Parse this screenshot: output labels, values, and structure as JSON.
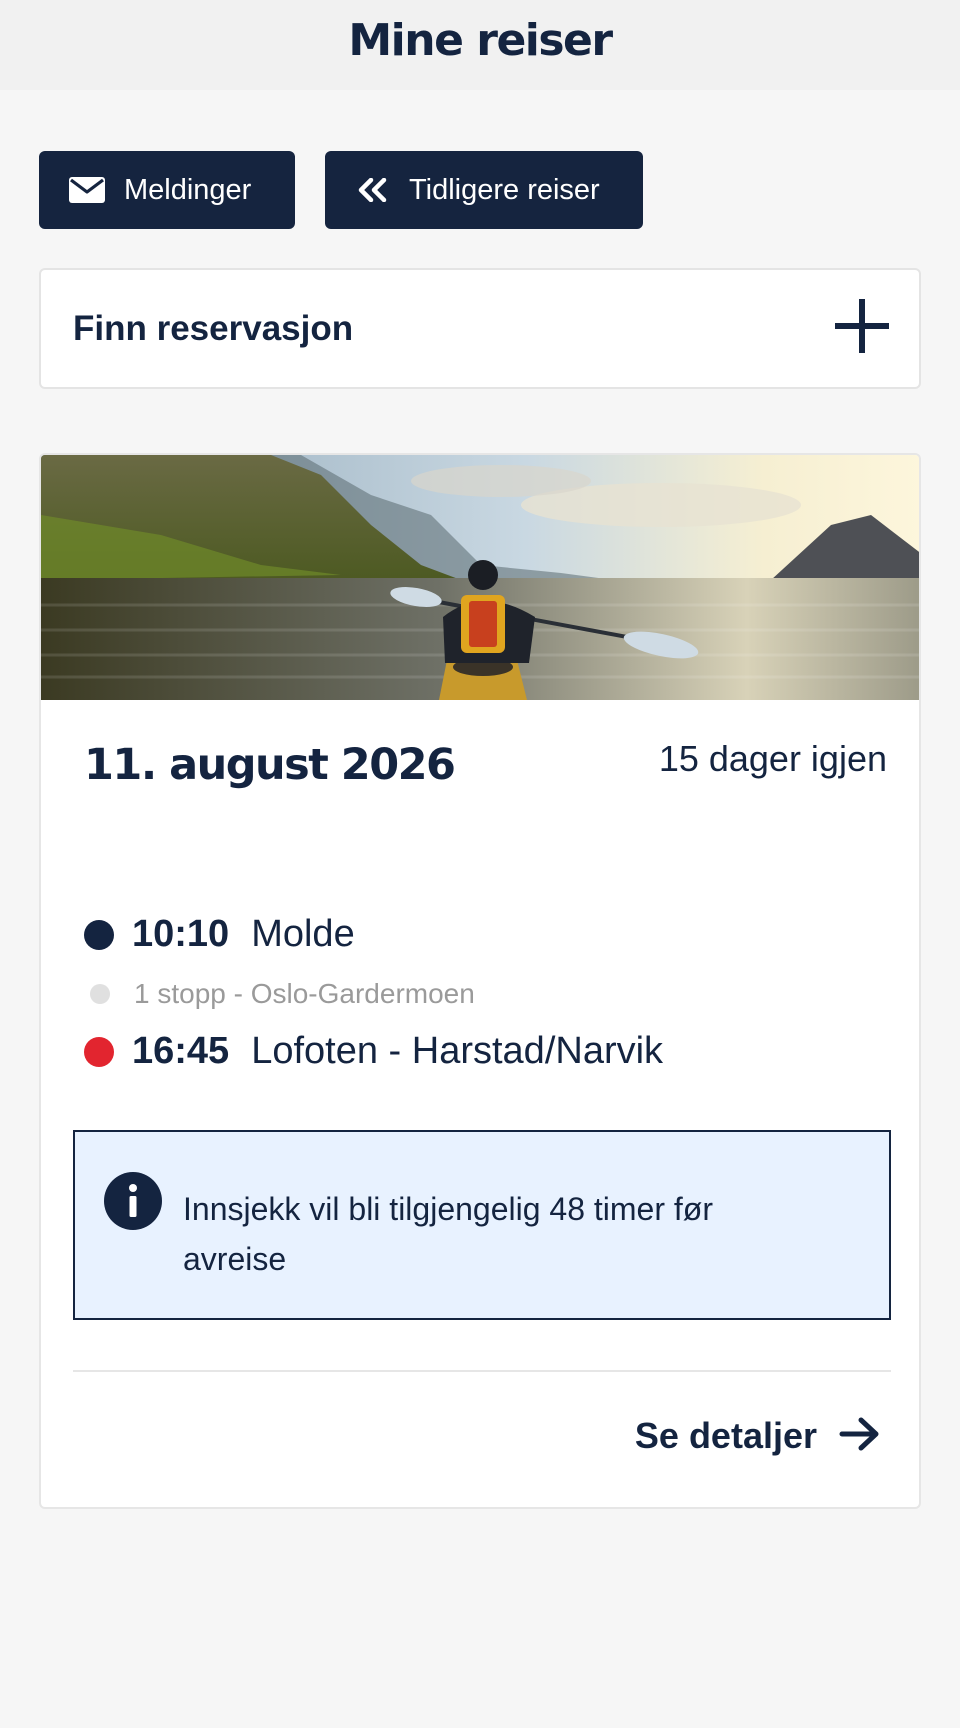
{
  "header": {
    "title": "Mine reiser"
  },
  "actions": {
    "messages": {
      "label": "Meldinger",
      "icon": "envelope-icon"
    },
    "previous_trips": {
      "label": "Tidligere reiser",
      "icon": "double-chevron-left-icon"
    }
  },
  "find_reservation": {
    "label": "Finn reservasjon",
    "icon": "plus-icon"
  },
  "trip": {
    "image": "kayak-fjord-photo",
    "date": "11. august 2026",
    "countdown": "15 dager igjen",
    "departure": {
      "time": "10:10",
      "place": "Molde",
      "dot_color": "#142440"
    },
    "stopover": {
      "text": "1 stopp - Oslo-Gardermoen",
      "dot_color": "#e0e0e0"
    },
    "arrival": {
      "time": "16:45",
      "place": "Lofoten - Harstad/Narvik",
      "dot_color": "#e2252f"
    },
    "info": {
      "icon": "info-icon",
      "text": "Innsjekk vil bli tilgjengelig 48 timer før avreise"
    },
    "details_link": {
      "label": "Se detaljer",
      "icon": "arrow-right-icon"
    }
  },
  "colors": {
    "brand_navy": "#142440",
    "info_bg": "#e8f2ff",
    "arrival_red": "#e2252f"
  }
}
